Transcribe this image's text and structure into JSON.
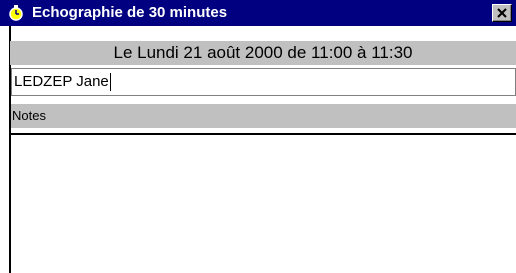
{
  "window": {
    "title": "Echographie de 30 minutes",
    "icon": "clock-icon",
    "close_icon": "close-icon"
  },
  "appointment": {
    "date_line": "Le Lundi 21 août 2000 de 11:00 à 11:30"
  },
  "patient": {
    "name": "LEDZEP Jane"
  },
  "notes": {
    "label": "Notes",
    "content": ""
  },
  "colors": {
    "titlebar": "#000080",
    "panel": "#c0c0c0",
    "background": "#ffffff"
  }
}
